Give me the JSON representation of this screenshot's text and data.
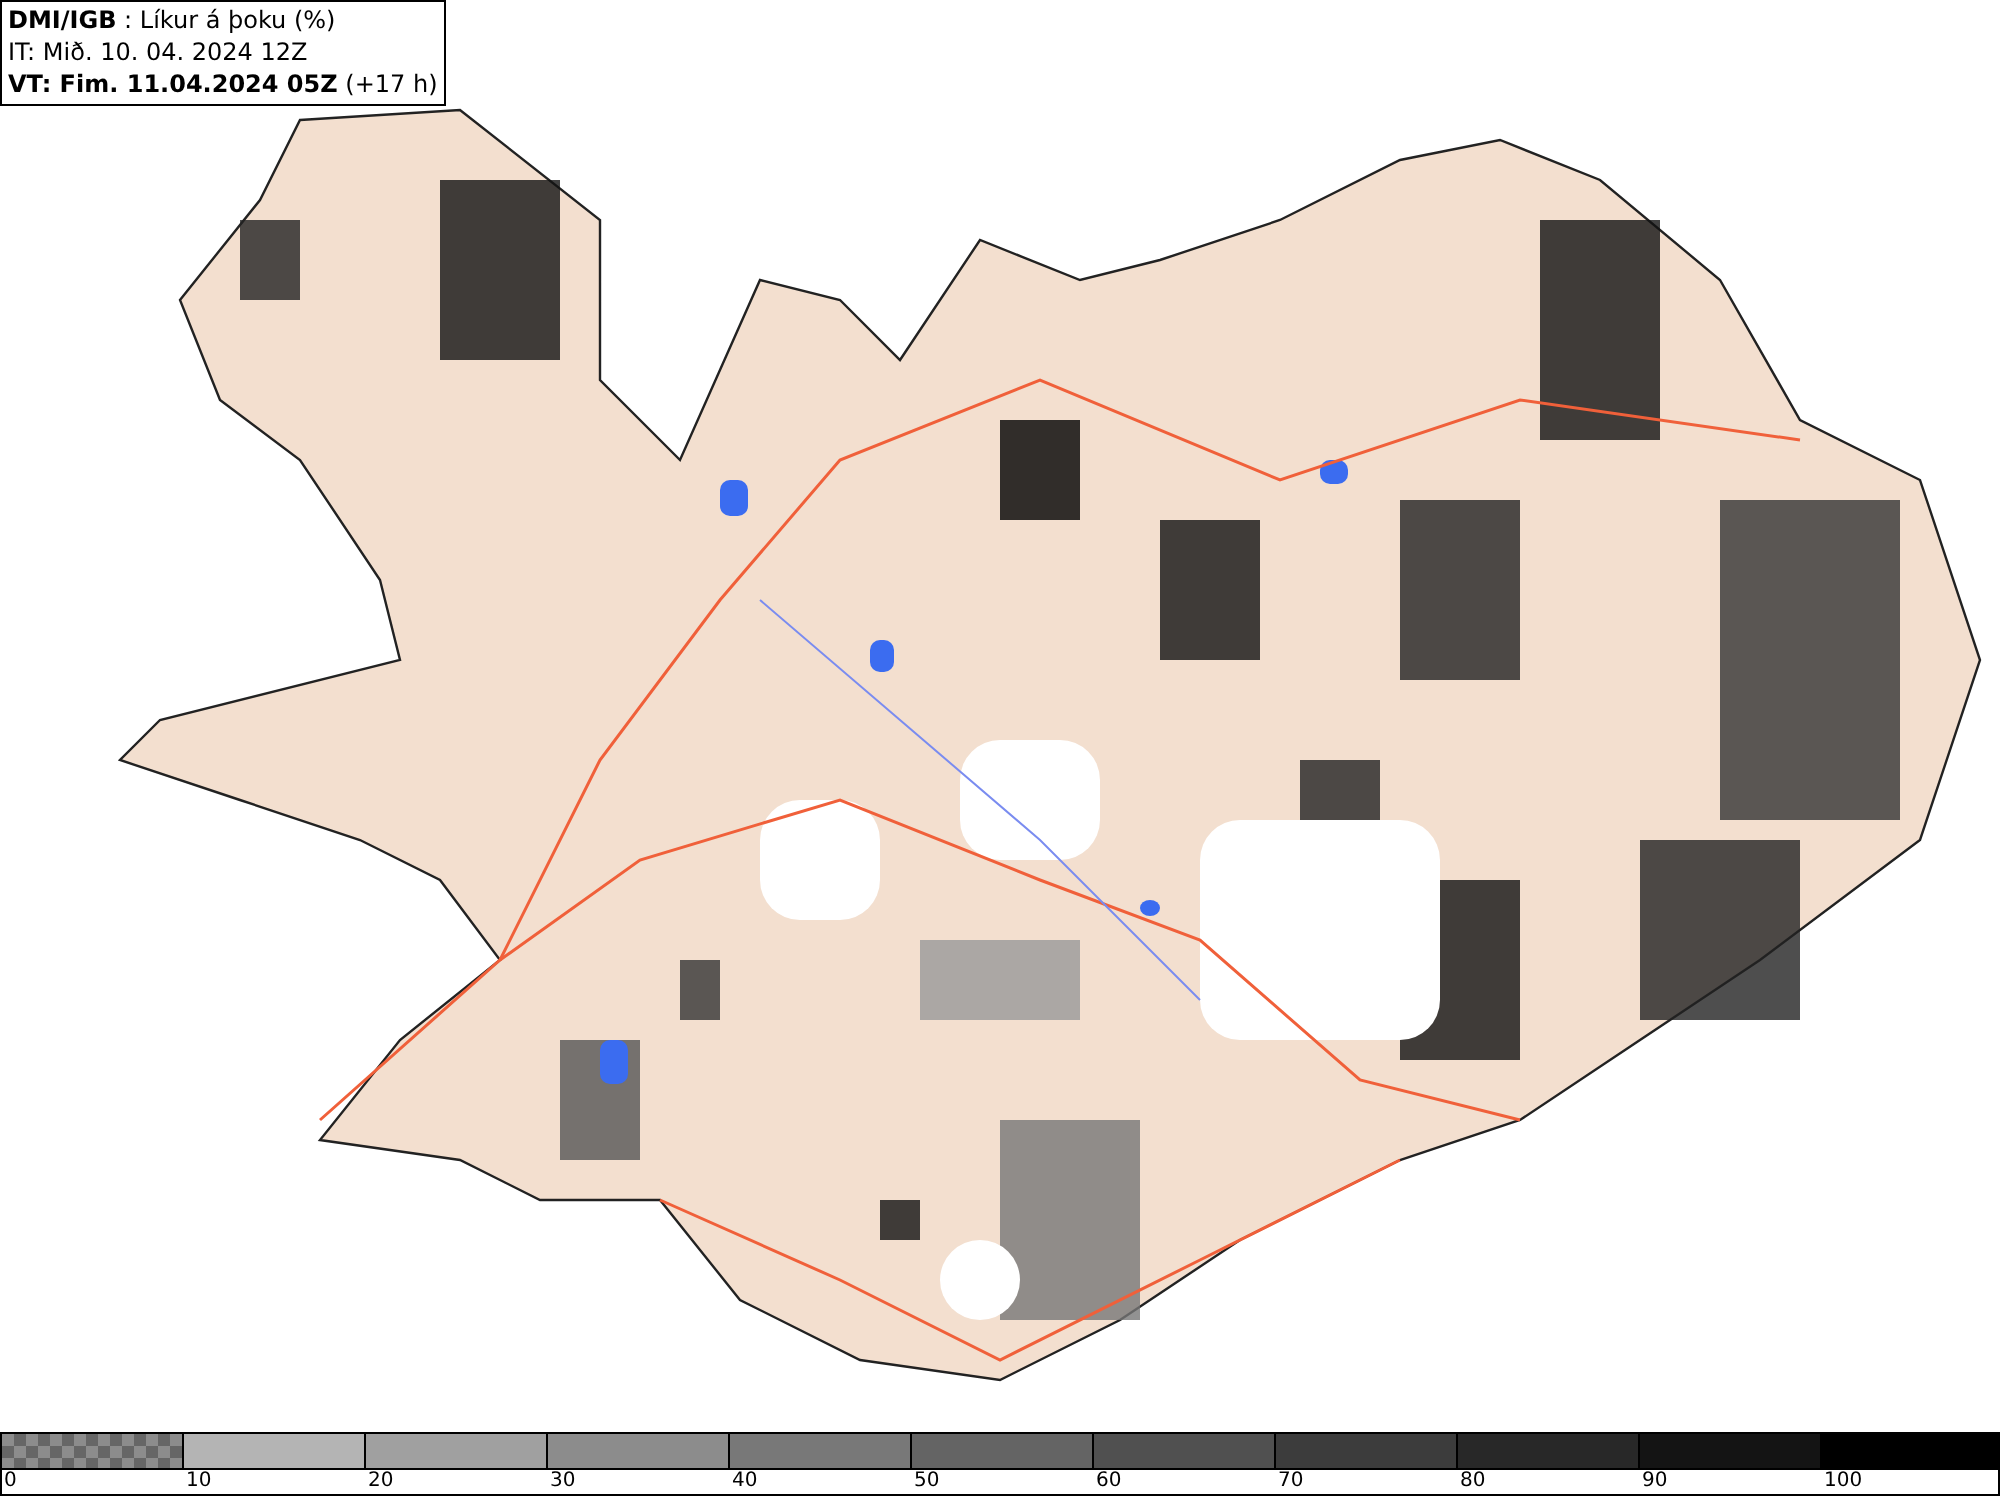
{
  "header": {
    "lines": [
      "**DMI/IGB** : Líkur á þoku (%)",
      "IT: Mið. 10. 04. 2024 12Z",
      "**VT: Fim. 11.04.2024 05Z** (+17 h)"
    ]
  },
  "legend": {
    "segments": [
      {
        "kind": "checker",
        "color": "#8c8c8c",
        "label": "0"
      },
      {
        "kind": "solid",
        "color": "#b4b4b4",
        "label": "10"
      },
      {
        "kind": "solid",
        "color": "#a0a0a0",
        "label": "20"
      },
      {
        "kind": "solid",
        "color": "#8c8c8c",
        "label": "30"
      },
      {
        "kind": "solid",
        "color": "#787878",
        "label": "40"
      },
      {
        "kind": "solid",
        "color": "#646464",
        "label": "50"
      },
      {
        "kind": "solid",
        "color": "#505050",
        "label": "60"
      },
      {
        "kind": "solid",
        "color": "#3c3c3c",
        "label": "70"
      },
      {
        "kind": "solid",
        "color": "#282828",
        "label": "80"
      },
      {
        "kind": "solid",
        "color": "#141414",
        "label": "90"
      },
      {
        "kind": "solid",
        "color": "#000000",
        "label": "100"
      }
    ]
  }
}
